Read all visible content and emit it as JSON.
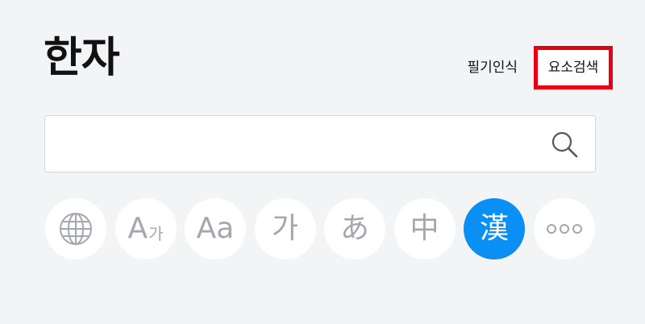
{
  "header": {
    "title": "한자",
    "links": {
      "handwriting": "필기인식",
      "component_search": "요소검색"
    }
  },
  "search": {
    "value": "",
    "placeholder": ""
  },
  "language_buttons": [
    {
      "name": "globe",
      "label": "",
      "icon": "globe-icon",
      "active": false
    },
    {
      "name": "english-korean",
      "label": "A",
      "sub": "가",
      "active": false
    },
    {
      "name": "english",
      "label": "Aa",
      "active": false
    },
    {
      "name": "korean",
      "label": "가",
      "active": false
    },
    {
      "name": "japanese",
      "label": "あ",
      "active": false
    },
    {
      "name": "chinese",
      "label": "中",
      "active": false
    },
    {
      "name": "hanja",
      "label": "漢",
      "active": true
    },
    {
      "name": "more",
      "label": "",
      "icon": "more-icon",
      "active": false
    }
  ],
  "colors": {
    "background": "#f3f4f6",
    "accent": "#0a90f5",
    "highlight_border": "#e60012",
    "icon_gray": "#a3a7ae"
  }
}
